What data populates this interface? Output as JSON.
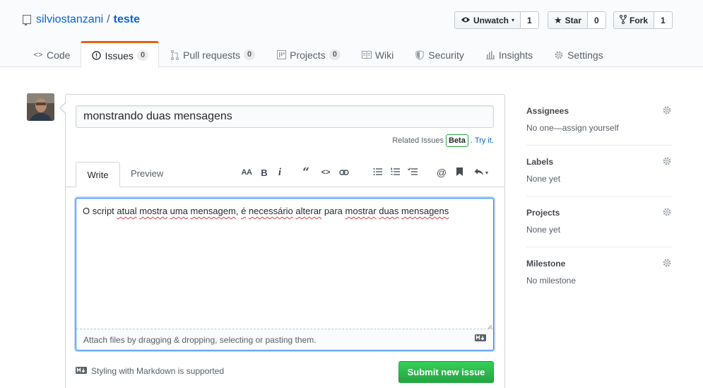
{
  "repo": {
    "owner": "silviostanzani",
    "separator": "/",
    "name": "teste"
  },
  "actions": {
    "watch": {
      "label": "Unwatch",
      "count": "1"
    },
    "star": {
      "label": "Star",
      "count": "0"
    },
    "fork": {
      "label": "Fork",
      "count": "1"
    }
  },
  "tabs": [
    {
      "label": "Code",
      "icon": "code-icon"
    },
    {
      "label": "Issues",
      "count": "0",
      "icon": "issue-opened-icon",
      "selected": true
    },
    {
      "label": "Pull requests",
      "count": "0",
      "icon": "git-pull-request-icon"
    },
    {
      "label": "Projects",
      "count": "0",
      "icon": "project-icon"
    },
    {
      "label": "Wiki",
      "icon": "book-icon"
    },
    {
      "label": "Security",
      "icon": "shield-icon"
    },
    {
      "label": "Insights",
      "icon": "graph-icon"
    },
    {
      "label": "Settings",
      "icon": "gear-icon"
    }
  ],
  "issue_form": {
    "title_value": "monstrando duas mensagens",
    "related": {
      "label": "Related Issues",
      "badge": "Beta",
      "sep": ".",
      "link": "Try it."
    },
    "write_tab": "Write",
    "preview_tab": "Preview",
    "toolbar": {
      "header": "AA",
      "bold": "B",
      "italic": "i"
    },
    "comment": {
      "segments": [
        {
          "t": "O script ",
          "spell": false
        },
        {
          "t": "atual",
          "spell": true
        },
        {
          "t": " ",
          "spell": false
        },
        {
          "t": "mostra",
          "spell": true
        },
        {
          "t": " ",
          "spell": false
        },
        {
          "t": "uma",
          "spell": true
        },
        {
          "t": " ",
          "spell": false
        },
        {
          "t": "mensagem",
          "spell": true
        },
        {
          "t": ", ",
          "spell": false
        },
        {
          "t": "é",
          "spell": true
        },
        {
          "t": " ",
          "spell": false
        },
        {
          "t": "necessário",
          "spell": true
        },
        {
          "t": " ",
          "spell": false
        },
        {
          "t": "alterar",
          "spell": true
        },
        {
          "t": " para ",
          "spell": false
        },
        {
          "t": "mostrar",
          "spell": true
        },
        {
          "t": " ",
          "spell": false
        },
        {
          "t": "duas",
          "spell": true
        },
        {
          "t": " ",
          "spell": false
        },
        {
          "t": "mensagens",
          "spell": true
        }
      ]
    },
    "attach_text": "Attach files by dragging & dropping, selecting or pasting them.",
    "markdown_note": "Styling with Markdown is supported",
    "submit_label": "Submit new issue"
  },
  "sidebar": {
    "assignees": {
      "heading": "Assignees",
      "value": "No one—assign yourself"
    },
    "labels": {
      "heading": "Labels",
      "value": "None yet"
    },
    "projects": {
      "heading": "Projects",
      "value": "None yet"
    },
    "milestone": {
      "heading": "Milestone",
      "value": "No milestone"
    }
  },
  "colors": {
    "link": "#0366d6",
    "accent_tab": "#e36209",
    "submit": "#28a745",
    "focus": "#2188ff"
  }
}
